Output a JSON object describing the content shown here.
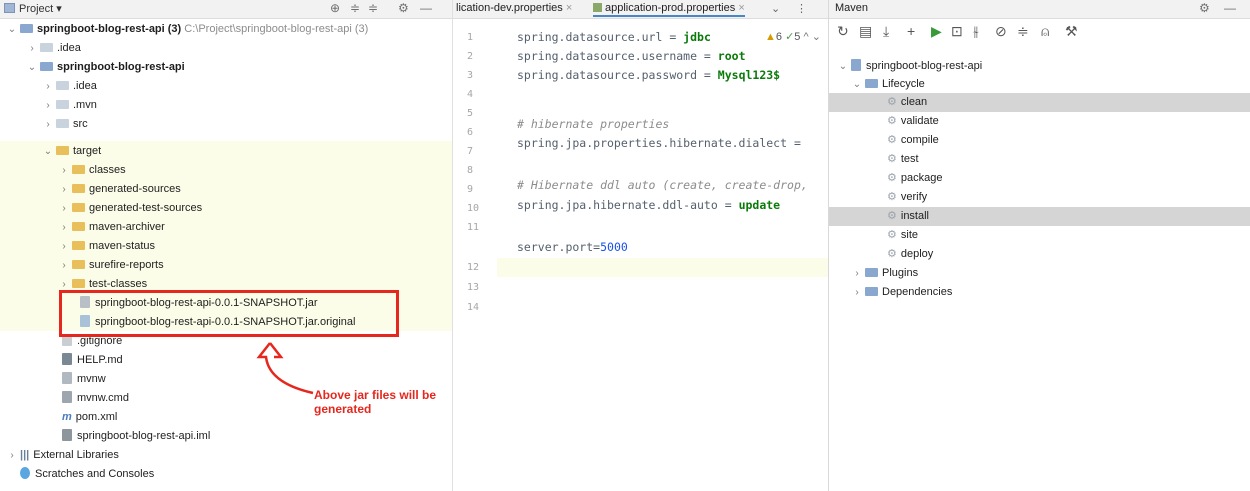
{
  "project_panel": {
    "title": "Project",
    "header_icons": [
      "⊕",
      "≑",
      "≑",
      "⚙",
      "—"
    ],
    "tree": [
      {
        "label": "springboot-blog-rest-api (3)",
        "path": "C:\\Project\\springboot-blog-rest-api (3)"
      },
      {
        "label": ".idea"
      },
      {
        "label": "springboot-blog-rest-api"
      },
      {
        "label": ".idea"
      },
      {
        "label": ".mvn"
      },
      {
        "label": "src"
      },
      {
        "label": "target"
      },
      {
        "label": "classes"
      },
      {
        "label": "generated-sources"
      },
      {
        "label": "generated-test-sources"
      },
      {
        "label": "maven-archiver"
      },
      {
        "label": "maven-status"
      },
      {
        "label": "surefire-reports"
      },
      {
        "label": "test-classes"
      },
      {
        "label": "springboot-blog-rest-api-0.0.1-SNAPSHOT.jar"
      },
      {
        "label": "springboot-blog-rest-api-0.0.1-SNAPSHOT.jar.original"
      },
      {
        "label": ".gitignore"
      },
      {
        "label": "HELP.md"
      },
      {
        "label": "mvnw"
      },
      {
        "label": "mvnw.cmd"
      },
      {
        "label": "pom.xml"
      },
      {
        "label": "springboot-blog-rest-api.iml"
      },
      {
        "label": "External Libraries"
      },
      {
        "label": "Scratches and Consoles"
      }
    ]
  },
  "annotation": "Above jar files will be generated",
  "editor": {
    "tabs": [
      "lication-dev.properties",
      "application-prod.properties"
    ],
    "inspection": {
      "warnings": "6",
      "checks": "5"
    },
    "line_numbers": [
      "1",
      "2",
      "3",
      "4",
      "5",
      "6",
      "7",
      "8",
      "9",
      "10",
      "11",
      "12",
      "13",
      "14"
    ],
    "lines": [
      {
        "key": "spring.datasource.url = ",
        "value": "jdbc"
      },
      {
        "key": "spring.datasource.username = ",
        "value": "root"
      },
      {
        "key": "spring.datasource.password = ",
        "value": "Mysql123$"
      },
      {
        "comment": "# hibernate properties"
      },
      {
        "key": "spring.jpa.properties.hibernate.dialect ="
      },
      {
        "comment": "# Hibernate ddl auto (create, create-drop,"
      },
      {
        "key": "spring.jpa.hibernate.ddl-auto = ",
        "value": "update"
      },
      {
        "key": "server.port=",
        "value": "5000"
      }
    ]
  },
  "maven": {
    "title": "Maven",
    "project": "springboot-blog-rest-api",
    "lifecycle_label": "Lifecycle",
    "goals": [
      "clean",
      "validate",
      "compile",
      "test",
      "package",
      "verify",
      "install",
      "site",
      "deploy"
    ],
    "plugins_label": "Plugins",
    "dependencies_label": "Dependencies"
  },
  "colors": {
    "annotation": "#e5271e",
    "selection": "#d5d5d5",
    "highlight": "#fcfde8"
  }
}
